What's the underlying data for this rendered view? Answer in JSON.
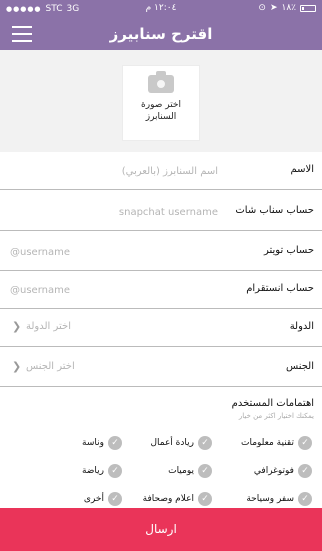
{
  "statusbar": {
    "carrier": "STC",
    "network": "3G",
    "time": "١٢:٠٤ م",
    "battery": "١٨٪"
  },
  "navbar": {
    "title": "اقترح سنابيرز",
    "menu_icon": "hamburger-menu-icon"
  },
  "photo": {
    "icon": "camera-icon",
    "label_line1": "اختر صورة",
    "label_line2": "السنابرز"
  },
  "form": {
    "name": {
      "label": "الاسم",
      "placeholder": "اسم السنابرز (بالعربي)"
    },
    "snapchat": {
      "label": "حساب سناب شات",
      "placeholder": "snapchat username"
    },
    "twitter": {
      "label": "حساب تويتر",
      "placeholder": "@username"
    },
    "instagram": {
      "label": "حساب انستقرام",
      "placeholder": "@username"
    },
    "country": {
      "label": "الدولة",
      "value": "اختر الدولة"
    },
    "gender": {
      "label": "الجنس",
      "value": "اختر الجنس"
    }
  },
  "interests": {
    "title": "اهتمامات المستخدم",
    "subtitle": "يمكنك اختيار اكثر من خيار",
    "items": [
      "تقنية معلومات",
      "ريادة أعمال",
      "وناسة",
      "فوتوغرافي",
      "يوميات",
      "رياضة",
      "سفر وسياحة",
      "اعلام وصحافة",
      "أخرى"
    ]
  },
  "submit_label": "ارسال"
}
